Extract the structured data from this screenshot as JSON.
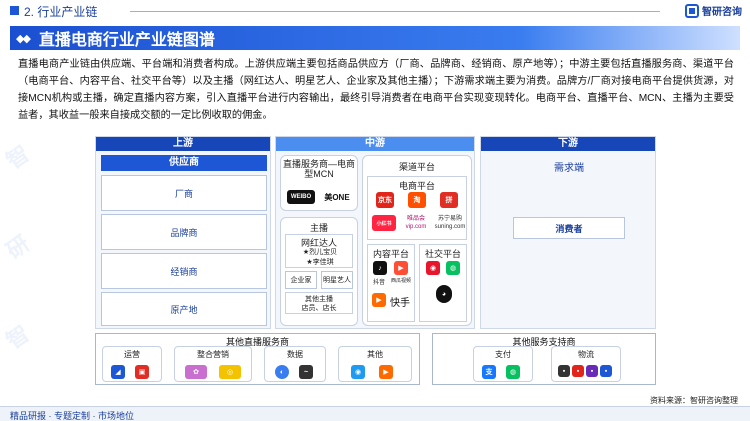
{
  "header": {
    "section": "2. 行业产业链",
    "logo_text": "智研咨询"
  },
  "title": "直播电商行业产业链图谱",
  "paragraph": "直播电商产业链由供应端、平台端和消费者构成。上游供应端主要包括商品供应方（厂商、品牌商、经销商、原产地等）；中游主要包括直播服务商、渠道平台（电商平台、内容平台、社交平台等）以及主播（网红达人、明星艺人、企业家及其他主播）；下游需求端主要为消费。品牌方/厂商对接电商平台提供货源，对接MCN机构或主播，确定直播内容方案，引入直播平台进行内容输出，最终引导消费者在电商平台实现变现转化。电商平台、直播平台、MCN、主播为主要受益者，其收益一般来自接成交额的一定比例收取的佣金。",
  "upstream": {
    "title": "上游",
    "subtitle": "供应商",
    "items": [
      "厂商",
      "品牌商",
      "经销商",
      "原产地"
    ]
  },
  "midstream": {
    "title": "中游",
    "service": {
      "title": "直播服务商—电商型MCN",
      "logos": [
        "WEIBO",
        "美ONE"
      ]
    },
    "anchor": {
      "title": "主播",
      "influencer": "网红达人",
      "names": [
        "烈儿宝贝",
        "李佳琪"
      ],
      "enterprise": "企业家",
      "star": "明星艺人",
      "other": "其他主播",
      "other_sub": "店员、店长"
    },
    "channel": {
      "title": "渠道平台",
      "ecommerce": {
        "title": "电商平台",
        "logos": [
          "京东",
          "淘",
          "拼",
          "小红书",
          "唯品会",
          "苏宁易购"
        ],
        "sub_labels": [
          "唯品会 vip.com",
          "苏宁易购 suning.com"
        ]
      },
      "content": {
        "title": "内容平台",
        "labels": [
          "抖音",
          "西瓜视频",
          "快手"
        ]
      },
      "social": {
        "title": "社交平台"
      }
    }
  },
  "downstream": {
    "title": "下游",
    "demand": "需求端",
    "consumer": "消费者"
  },
  "bottom": {
    "left_title": "其他直播服务商",
    "left_items": [
      "运营",
      "整合营销",
      "数据",
      "其他"
    ],
    "right_title": "其他服务支持商",
    "right_items": [
      "支付",
      "物流"
    ]
  },
  "footer": {
    "left": "精品研报 · 专题定制 · 市场地位",
    "source": "资料来源：智研咨询整理"
  },
  "colors": {
    "primary": "#1e57d6",
    "dark": "#1746b8",
    "light": "#4b8ef0",
    "panel": "#f3f6fb"
  }
}
